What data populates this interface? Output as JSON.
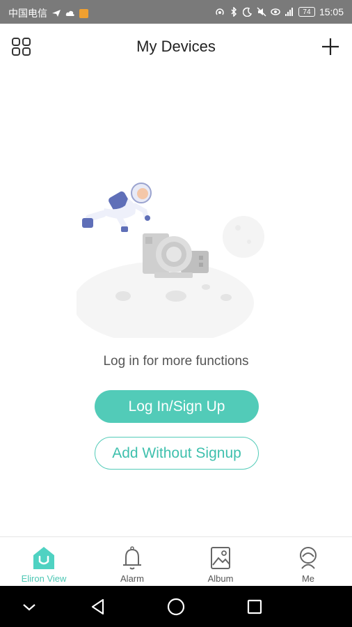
{
  "status_bar": {
    "carrier": "中国电信",
    "battery": "74",
    "time": "15:05"
  },
  "header": {
    "title": "My Devices"
  },
  "main": {
    "prompt": "Log in for more functions",
    "login_label": "Log In/Sign Up",
    "add_without_signup_label": "Add Without Signup"
  },
  "tabs": [
    {
      "label": "Eliron View",
      "icon": "home-icon",
      "active": true
    },
    {
      "label": "Alarm",
      "icon": "bell-icon",
      "active": false
    },
    {
      "label": "Album",
      "icon": "image-icon",
      "active": false
    },
    {
      "label": "Me",
      "icon": "person-icon",
      "active": false
    }
  ],
  "colors": {
    "accent": "#52cbb8",
    "status_bar": "#7a7a7a"
  }
}
